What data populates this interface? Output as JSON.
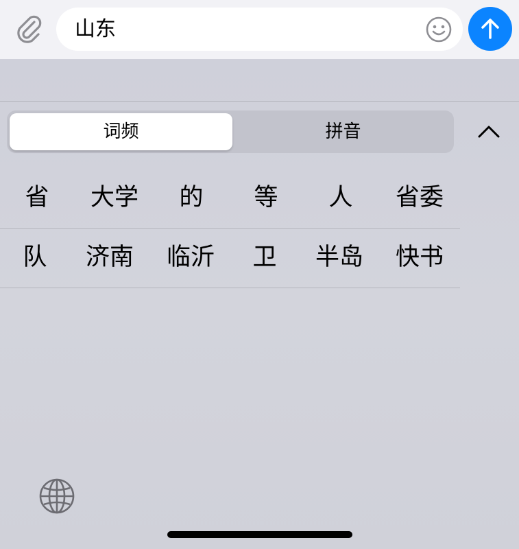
{
  "message_bar": {
    "input_value": "山东",
    "attach_icon": "paperclip-icon",
    "emoji_icon": "smiley-icon",
    "send_icon": "arrow-up-icon"
  },
  "keyboard": {
    "tabs": [
      {
        "label": "词频",
        "selected": true
      },
      {
        "label": "拼音",
        "selected": false
      }
    ],
    "collapse_icon": "chevron-up-icon",
    "candidates_row1": [
      "省",
      "大学",
      "的",
      "等",
      "人",
      "省委"
    ],
    "candidates_row2": [
      "队",
      "济南",
      "临沂",
      "卫",
      "半岛",
      "快书"
    ],
    "globe_icon": "globe-icon"
  },
  "colors": {
    "accent": "#0b84ff",
    "keyboard_bg": "#d2d3db",
    "top_bar_bg": "#f2f2f6"
  }
}
